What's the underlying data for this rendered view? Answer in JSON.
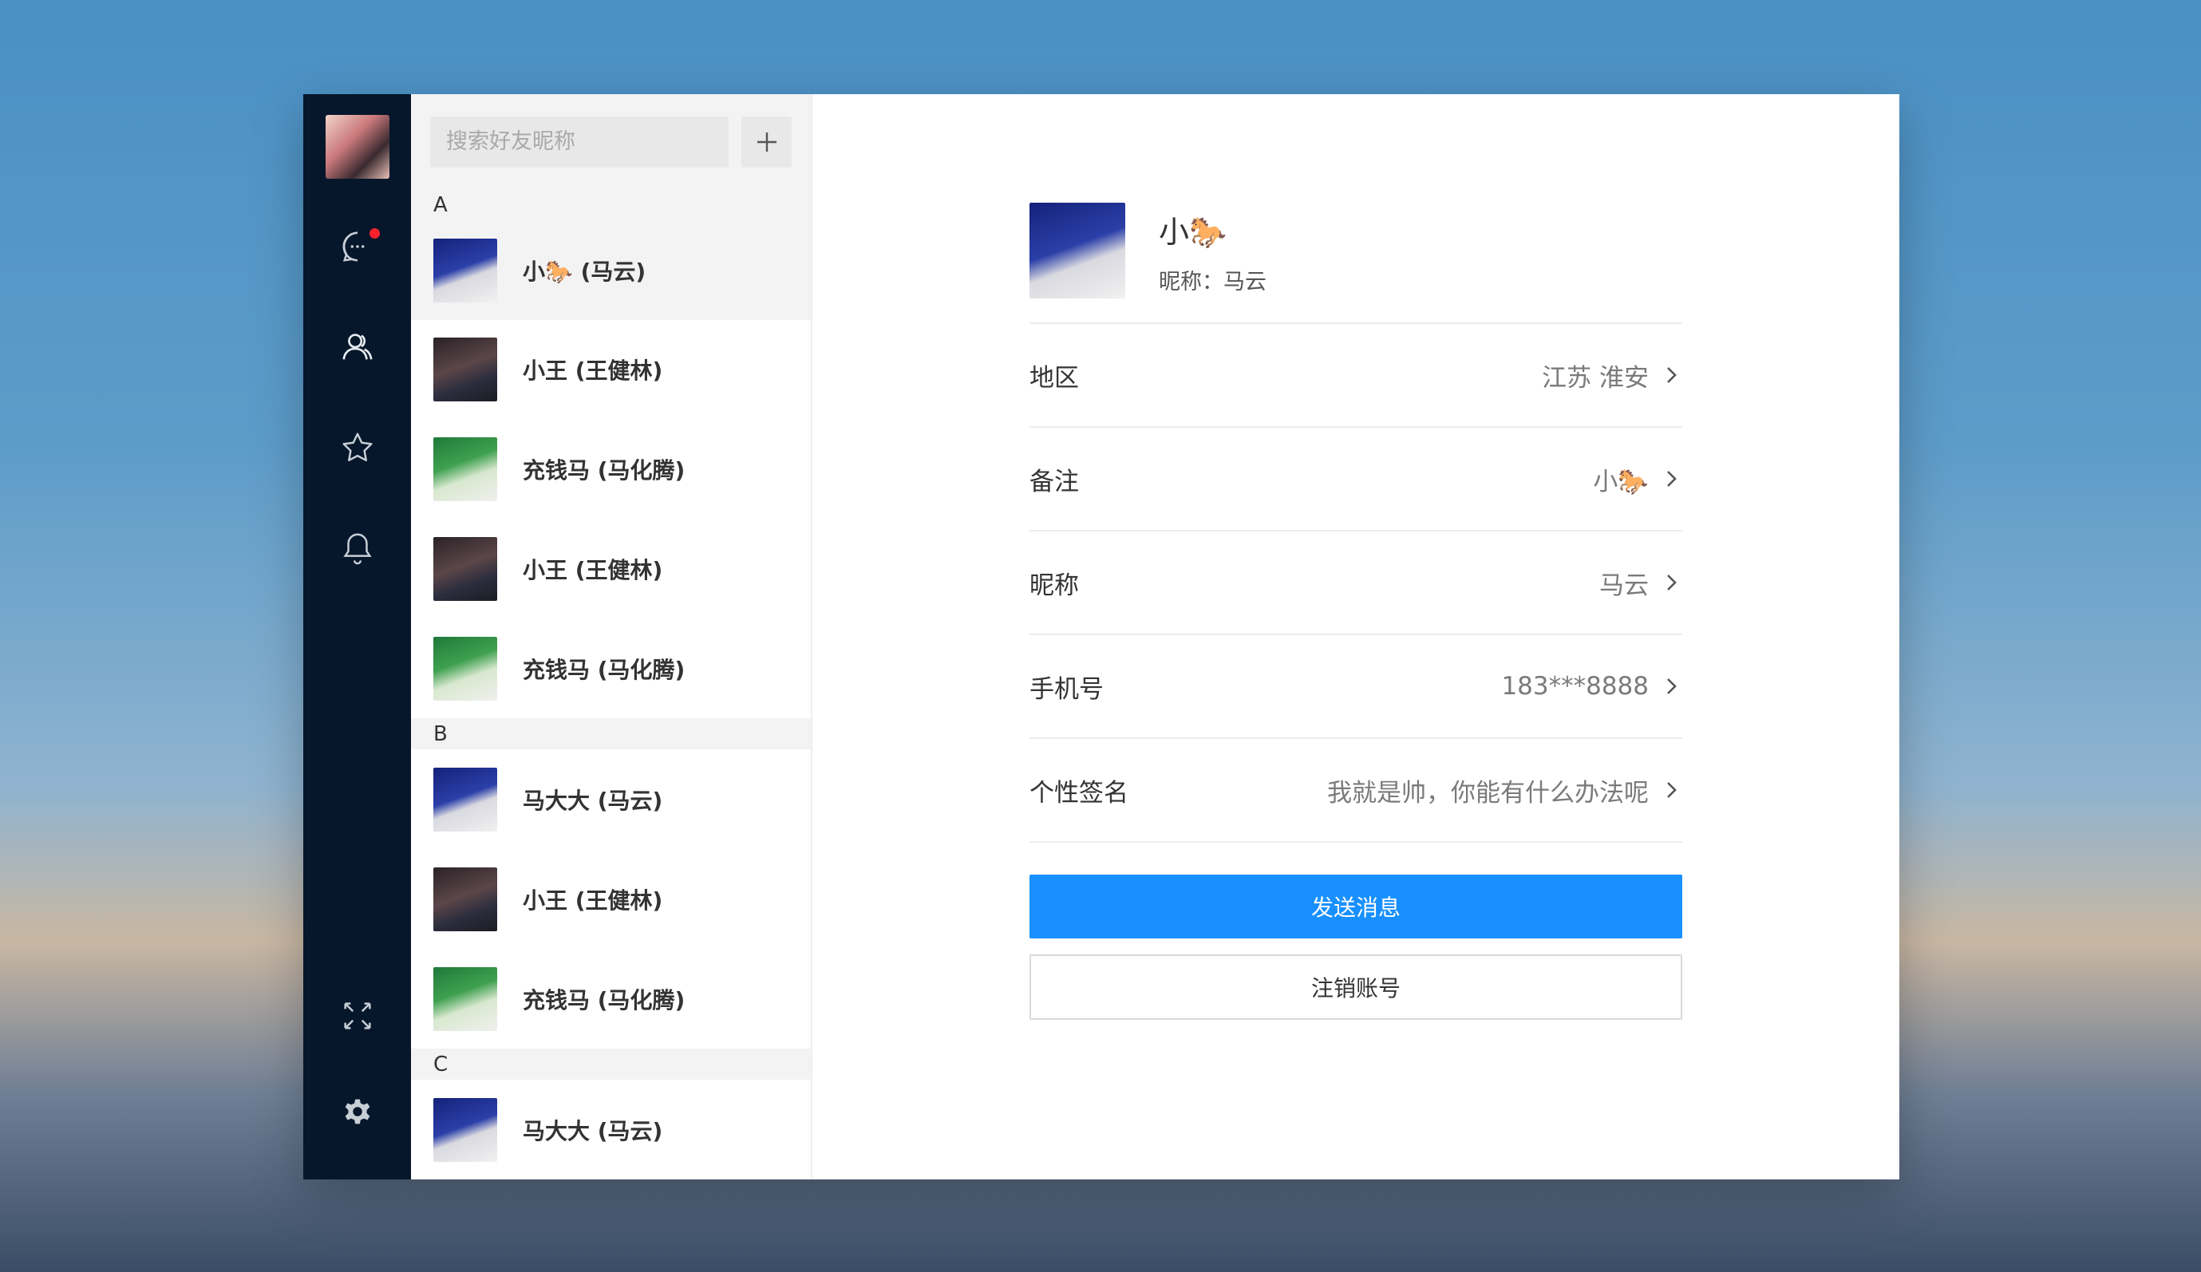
{
  "search": {
    "placeholder": "搜索好友昵称"
  },
  "nav": {
    "items": [
      {
        "icon": "chat-icon",
        "badge": true
      },
      {
        "icon": "contacts-icon"
      },
      {
        "icon": "star-icon"
      },
      {
        "icon": "bell-icon"
      }
    ],
    "bottom": [
      {
        "icon": "fullscreen-icon"
      },
      {
        "icon": "gear-icon"
      }
    ]
  },
  "contacts": {
    "sections": [
      {
        "letter": "A",
        "items": [
          {
            "name": "小🐎 (马云)"
          },
          {
            "name": "小王 (王健林)"
          },
          {
            "name": "充钱马 (马化腾)"
          },
          {
            "name": "小王 (王健林)"
          },
          {
            "name": "充钱马 (马化腾)"
          }
        ]
      },
      {
        "letter": "B",
        "items": [
          {
            "name": "马大大 (马云)"
          },
          {
            "name": "小王 (王健林)"
          },
          {
            "name": "充钱马 (马化腾)"
          }
        ]
      },
      {
        "letter": "C",
        "items": [
          {
            "name": "马大大 (马云)"
          }
        ]
      }
    ]
  },
  "detail": {
    "title": "小🐎",
    "nickname_line": "昵称：马云",
    "rows": [
      {
        "label": "地区",
        "value": "江苏 淮安"
      },
      {
        "label": "备注",
        "value": "小🐎"
      },
      {
        "label": "昵称",
        "value": "马云"
      },
      {
        "label": "手机号",
        "value": "183***8888"
      },
      {
        "label": "个性签名",
        "value": "我就是帅，你能有什么办法呢"
      }
    ],
    "send_label": "发送消息",
    "logout_label": "注销账号"
  },
  "colors": {
    "nav_bg": "#06172b",
    "accent": "#1890ff",
    "badge": "#f5222d"
  }
}
